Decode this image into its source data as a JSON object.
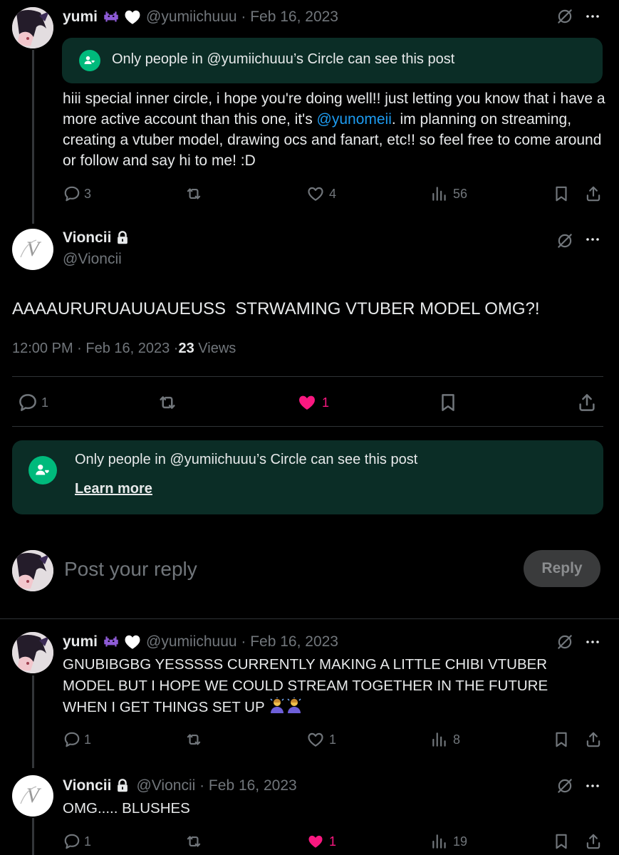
{
  "tweet1": {
    "name": "yumi",
    "handle_date": "@yumiichuuu · Feb 16, 2023",
    "circle_text": "Only people in @yumiichuuu’s Circle can see this post",
    "text_a": "hiii special inner circle, i hope you're doing well!! just letting you know that i have a more active account than this one, it's ",
    "mention": "@yunomeii",
    "text_b": ". im planning on streaming, creating a vtuber model, drawing ocs and fanart, etc!! so feel free to come around or follow and say hi to me! :D",
    "replies": "3",
    "likes": "4",
    "views": "56"
  },
  "main": {
    "name": "Vioncii",
    "handle": "@Vioncii",
    "text": "AAAAURURUAUUAUEUSS  STRWAMING VTUBER MODEL OMG?!",
    "time": "12:00 PM · Feb 16, 2023 · ",
    "view_count": "23",
    "views_label": "Views",
    "replies": "1",
    "likes": "1",
    "circle_text": "Only people in @yumiichuuu’s Circle can see this post",
    "learn_more": "Learn more"
  },
  "composer": {
    "placeholder": "Post your reply",
    "button": "Reply"
  },
  "reply1": {
    "name": "yumi",
    "handle_date": "@yumiichuuu · Feb 16, 2023",
    "text": "GNUBIBGBG YESSSSS CURRENTLY MAKING A LITTLE CHIBI VTUBER MODEL BUT I HOPE WE COULD STREAM TOGETHER IN THE FUTURE WHEN I GET THINGS SET UP",
    "replies": "1",
    "likes": "1",
    "views": "8"
  },
  "reply2": {
    "name": "Vioncii",
    "handle_date": "@Vioncii · Feb 16, 2023",
    "text": "OMG..... BLUSHES",
    "replies": "1",
    "likes": "1",
    "views": "19"
  },
  "colors": {
    "accent": "#1d9bf0",
    "like": "#f91880",
    "circle": "#00ba7c",
    "banner": "#0b2d26"
  }
}
